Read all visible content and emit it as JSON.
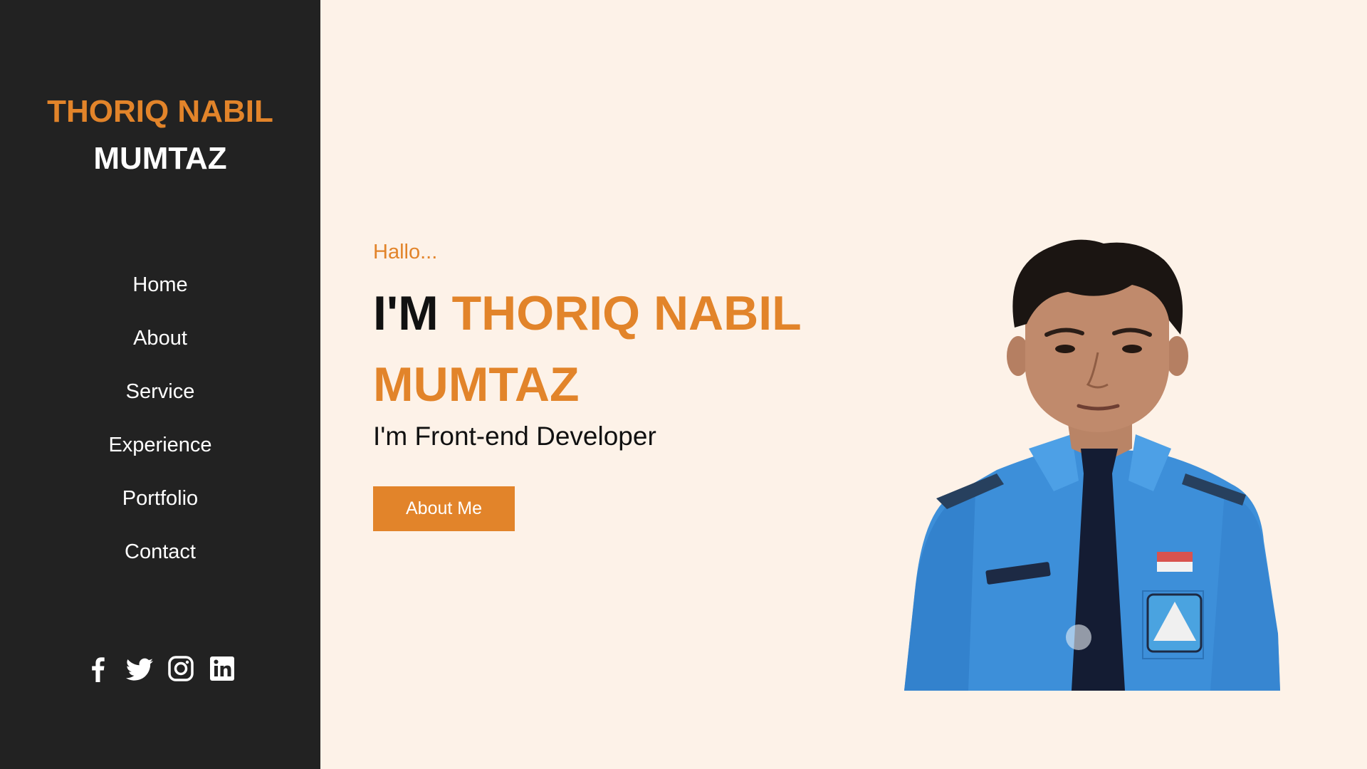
{
  "sidebar": {
    "brand_first": "THORIQ NABIL",
    "brand_last": "MUMTAZ",
    "nav": [
      {
        "label": "Home"
      },
      {
        "label": "About"
      },
      {
        "label": "Service"
      },
      {
        "label": "Experience"
      },
      {
        "label": "Portfolio"
      },
      {
        "label": "Contact"
      }
    ],
    "socials": [
      "facebook-icon",
      "twitter-icon",
      "instagram-icon",
      "linkedin-icon"
    ]
  },
  "hero": {
    "greeting": "Hallo...",
    "im": "I'M",
    "name_line1": "THORIQ NABIL",
    "name_line2": "MUMTAZ",
    "role": "I'm Front-end Developer",
    "button_label": "About Me"
  },
  "colors": {
    "accent": "#e2842a",
    "sidebar_bg": "#222222",
    "page_bg": "#fdf2e8"
  }
}
